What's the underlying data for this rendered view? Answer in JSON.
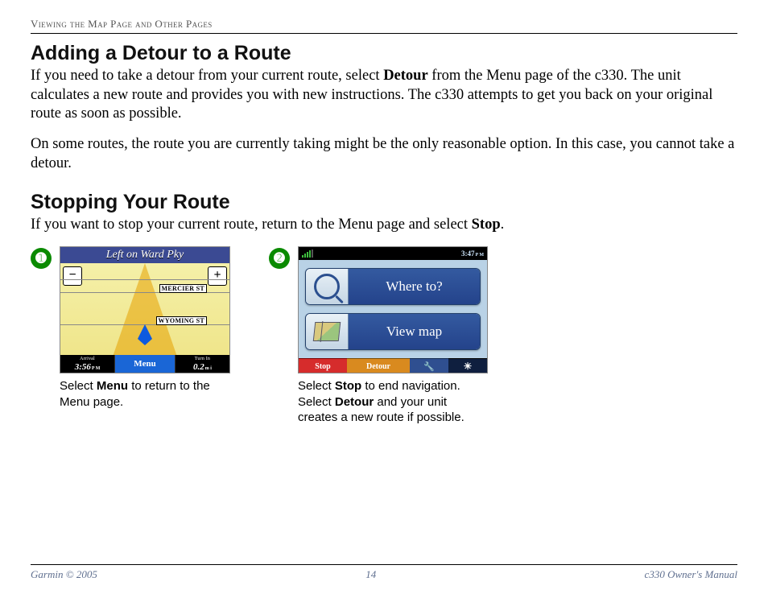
{
  "header": "Viewing the Map Page and Other Pages",
  "sec1": {
    "title": "Adding a Detour to a Route",
    "p1a": "If you need to take a detour from your current route, select ",
    "p1b": "Detour",
    "p1c": " from the Menu page of the c330. The unit calculates a new route and provides you with new instructions. The c330 attempts to get you back on your original route as soon as possible.",
    "p2": "On some routes, the route you are currently taking might be the only reasonable option. In this case, you cannot take a detour."
  },
  "sec2": {
    "title": "Stopping Your Route",
    "p1a": "If you want to stop your current route, return to the Menu page and select ",
    "p1b": "Stop",
    "p1c": "."
  },
  "steps": {
    "one": {
      "num": "➊"
    },
    "two": {
      "num": "➋"
    }
  },
  "mapshot": {
    "title": "Left on Ward Pky",
    "zin": "−",
    "zout": "+",
    "road1": "MERCIER ST",
    "road2": "WYOMING ST",
    "arrival_lbl": "Arrival",
    "arrival_val": "3:56",
    "arrival_unit": "P M",
    "menu_lbl": "Menu",
    "turn_lbl": "Turn In",
    "turn_val": "0.2",
    "turn_unit": "m i"
  },
  "menushot": {
    "clock": "3:47",
    "clock_unit": "P M",
    "where": "Where to?",
    "view": "View map",
    "stop": "Stop",
    "detour": "Detour",
    "tool": "🔧",
    "bright": "☀"
  },
  "cap1": {
    "a": "Select ",
    "b": "Menu",
    "c": " to return to the Menu page."
  },
  "cap2": {
    "a": "Select ",
    "b": "Stop",
    "c": " to end navigation. Select ",
    "d": "Detour",
    "e": " and your unit creates a new route if possible."
  },
  "footer": {
    "left": "Garmin © 2005",
    "mid": "14",
    "right": "c330 Owner's Manual"
  }
}
